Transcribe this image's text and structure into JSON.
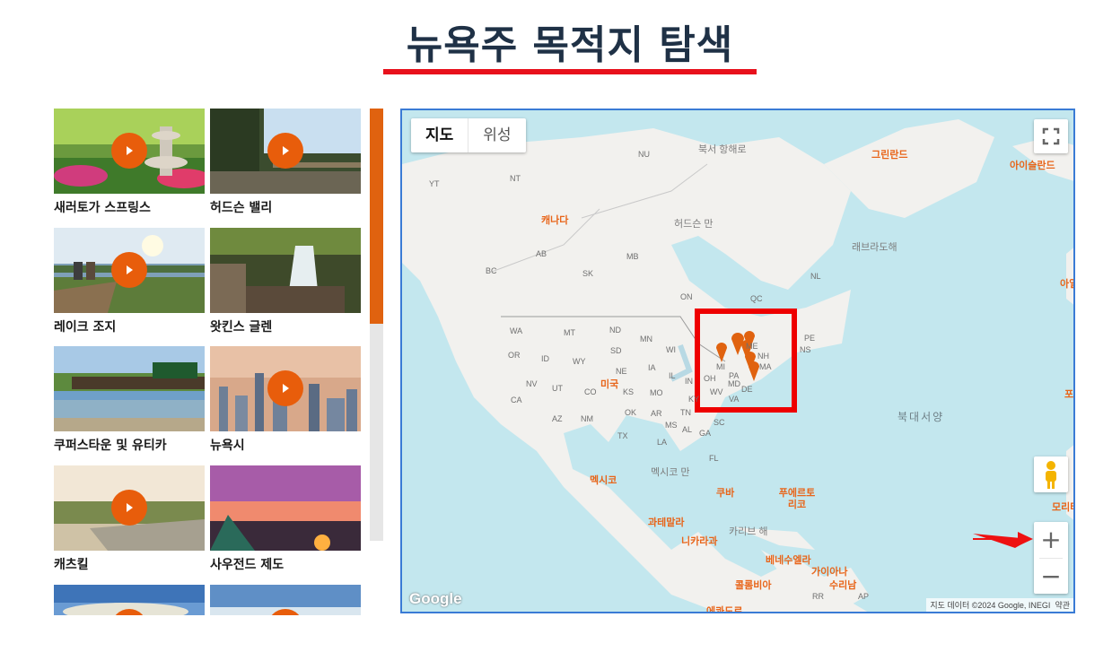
{
  "header": {
    "title": "뉴욕주 목적지 탐색"
  },
  "destinations": [
    {
      "label": "새러토가 스프링스"
    },
    {
      "label": "허드슨 밸리"
    },
    {
      "label": "레이크 조지"
    },
    {
      "label": "왓킨스 글렌"
    },
    {
      "label": "쿠퍼스타운 및 유티카"
    },
    {
      "label": "뉴욕시"
    },
    {
      "label": "캐츠킬"
    },
    {
      "label": "사우전드 제도"
    }
  ],
  "map": {
    "map_type_buttons": {
      "map": "지도",
      "satellite": "위성"
    },
    "zoom_in": "+",
    "zoom_out": "−",
    "labels": {
      "canada": "캐나다",
      "usa": "미국",
      "mexico": "멕시코",
      "greenland": "그린란드",
      "iceland": "아이슬란드",
      "cuba": "쿠바",
      "puerto_rico": "푸에르토\n리코",
      "guatemala": "과테말라",
      "nicaragua": "니카라과",
      "venezuela": "베네수엘라",
      "guyana": "가이아나",
      "suriname": "수리남",
      "colombia": "콜롬비아",
      "ecuador": "에콰도르",
      "hudson_bay": "허드슨 만",
      "north_sea": "북서 항해로",
      "labrador_sea": "래브라도해",
      "north_atlantic": "북대서양",
      "gulf_of_mexico": "멕시코 만",
      "caribbean": "카리브 해",
      "ireland_partial": "아일",
      "portugal_partial": "포",
      "moroccan_partial": "모리타",
      "provinces": [
        "NU",
        "NT",
        "YT",
        "BC",
        "AB",
        "SK",
        "MB",
        "ON",
        "QC",
        "NL",
        "PE",
        "NS"
      ],
      "states": [
        "WA",
        "OR",
        "CA",
        "ID",
        "NV",
        "UT",
        "AZ",
        "MT",
        "WY",
        "CO",
        "NM",
        "ND",
        "SD",
        "NE",
        "KS",
        "OK",
        "TX",
        "MN",
        "IA",
        "MO",
        "AR",
        "LA",
        "WI",
        "IL",
        "MS",
        "AL",
        "GA",
        "FL",
        "SC",
        "IN",
        "OH",
        "KY",
        "TN",
        "WV",
        "VA",
        "PA",
        "MD",
        "DE",
        "ME",
        "NH",
        "MA",
        "MI",
        "RR",
        "AP"
      ]
    },
    "attribution": "지도 데이터 ©2024 Google, INEGI",
    "terms": "약관",
    "google_logo": "Google"
  },
  "colors": {
    "accent": "#e0620f",
    "title_underline": "#e8111c",
    "highlight_box": "#ee0000",
    "arrow": "#ee1111",
    "map_border": "#3a7bd5"
  }
}
